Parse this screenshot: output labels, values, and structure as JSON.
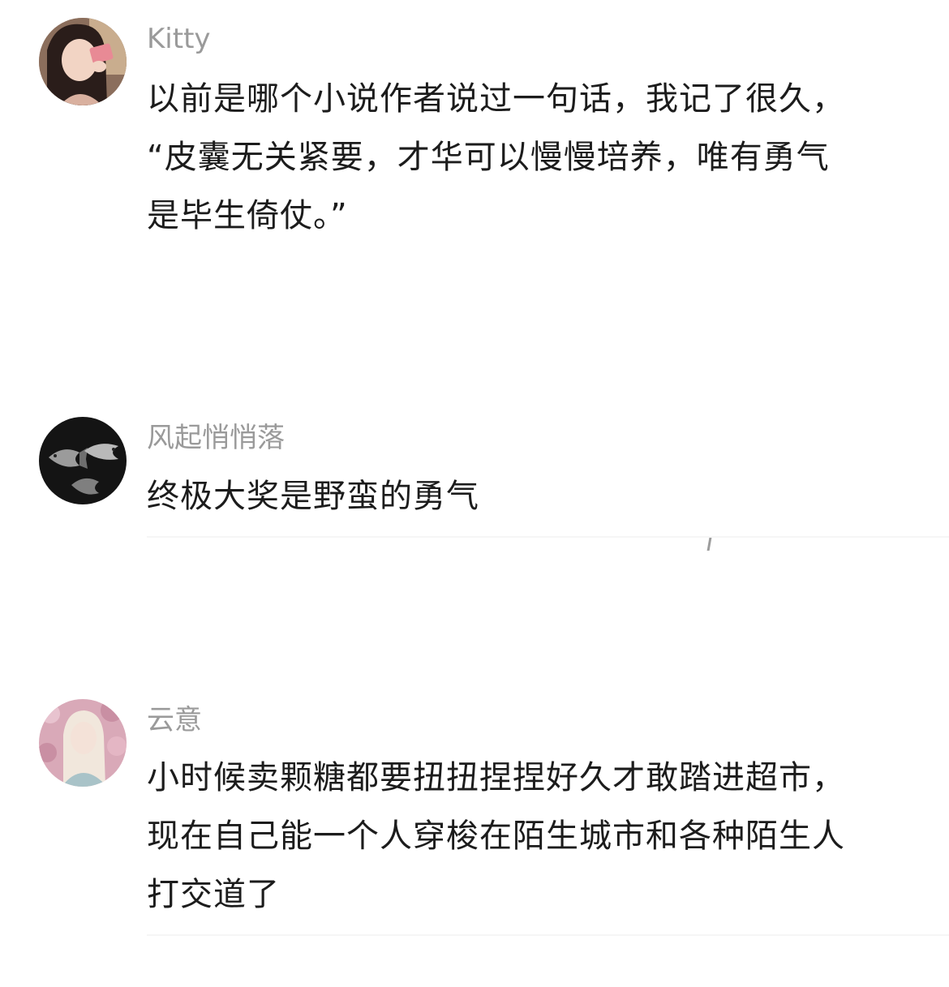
{
  "comments": [
    {
      "username": "Kitty",
      "avatar_icon": "user-photo-avatar",
      "lines": [
        "以前是哪个小说作者说过一句话，我记了很久，",
        "“皮囊无关紧要，才华可以慢慢培养，唯有勇气",
        "是毕生倚仗。”"
      ]
    },
    {
      "username": "风起悄悄落",
      "avatar_icon": "goldfish-avatar",
      "lines": [
        "终极大奖是野蛮的勇气"
      ]
    },
    {
      "username": "云意",
      "avatar_icon": "blossom-portrait-avatar",
      "lines": [
        "小时候卖颗糖都要扭扭捏捏好久才敢踏进超市，",
        "现在自己能一个人穿梭在陌生城市和各种陌生人",
        "打交道了"
      ]
    }
  ],
  "colors": {
    "username": "#9a9a9a",
    "content": "#1c1c1c",
    "background": "#ffffff"
  }
}
